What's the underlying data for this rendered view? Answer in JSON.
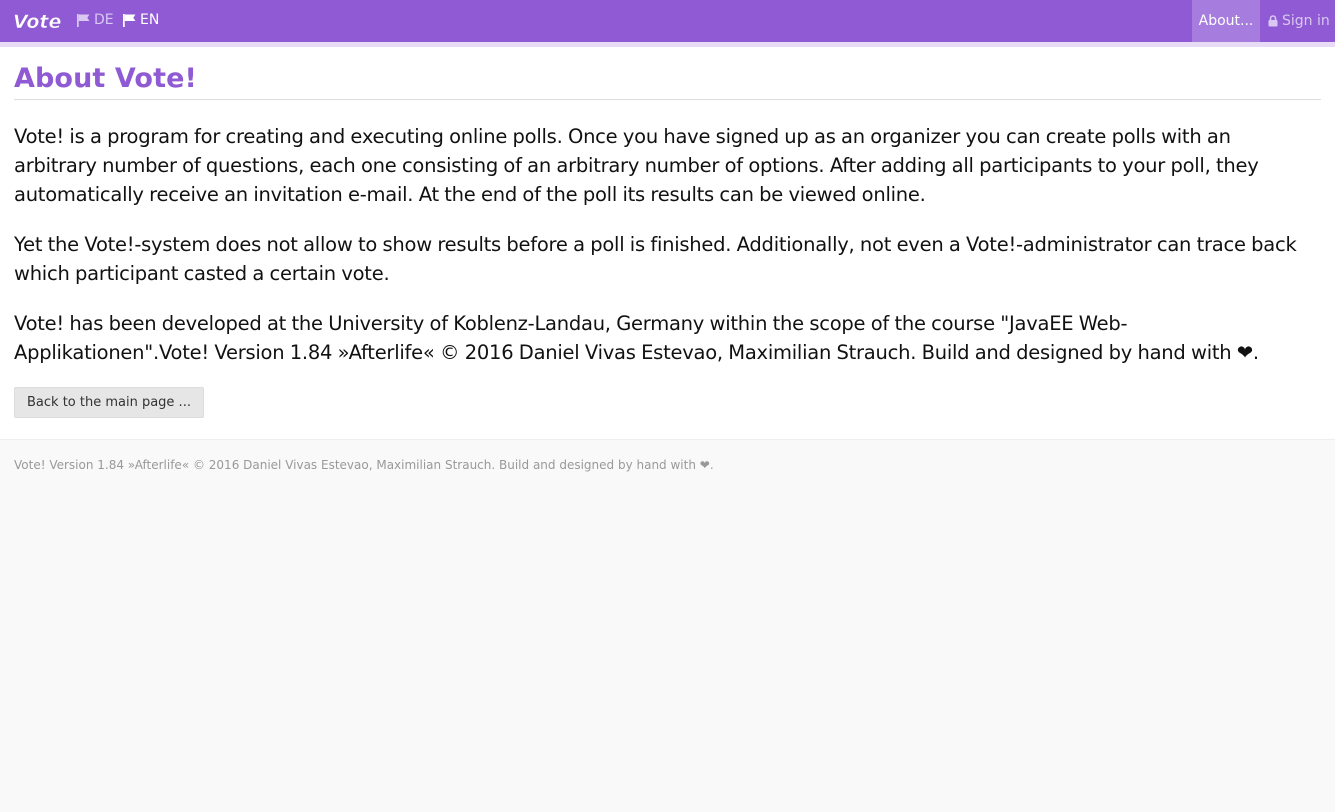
{
  "navbar": {
    "brand": "Vote!",
    "languages": [
      {
        "label": "DE",
        "active": false
      },
      {
        "label": "EN",
        "active": true
      }
    ],
    "about_label": "About...",
    "signin_label": "Sign in"
  },
  "main": {
    "title": "About Vote!",
    "paragraphs": [
      "Vote! is a program for creating and executing online polls. Once you have signed up as an organizer you can create polls with an arbitrary number of questions, each one consisting of an arbitrary number of options. After adding all participants to your poll, they automatically receive an invitation e-mail. At the end of the poll its results can be viewed online.",
      "Yet the Vote!-system does not allow to show results before a poll is finished. Additionally, not even a Vote!-administrator can trace back which participant casted a certain vote.",
      "Vote! has been developed at the University of Koblenz-Landau, Germany within the scope of the course \"JavaEE Web-Applikationen\".Vote! Version 1.84 »Afterlife« © 2016 Daniel Vivas Estevao, Maximilian Strauch. Build and designed by hand with ❤."
    ],
    "back_button_label": "Back to the main page ..."
  },
  "footer": {
    "text": "Vote! Version 1.84 »Afterlife« © 2016 Daniel Vivas Estevao, Maximilian Strauch. Build and designed by hand with ❤."
  },
  "colors": {
    "brand_purple": "#8f5ad3",
    "active_nav": "#a67ddf"
  },
  "icons": {
    "language": "flag-icon",
    "signin": "lock-icon"
  }
}
